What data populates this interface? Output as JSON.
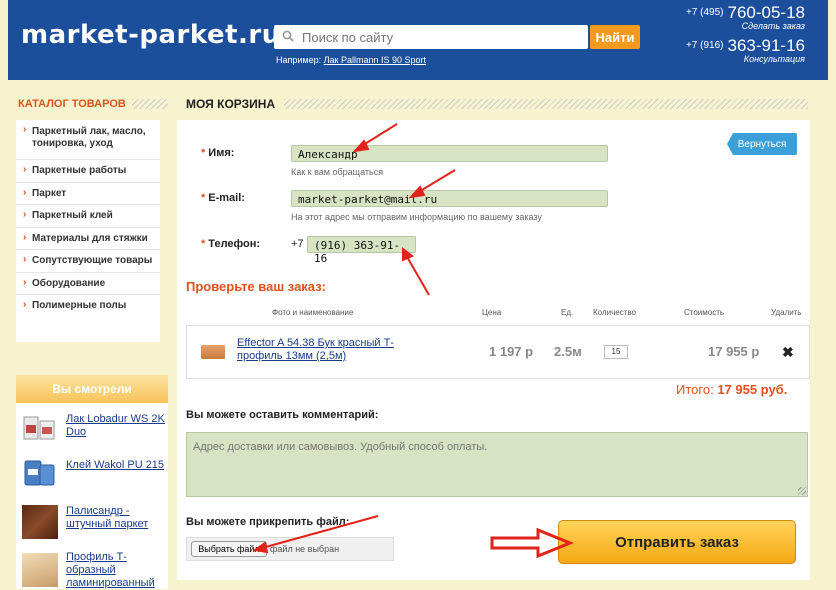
{
  "header": {
    "logo": "market-parket.ru",
    "search_placeholder": "Поиск по сайту",
    "search_button": "Найти",
    "example_prefix": "Например:",
    "example_link": "Лак Pallmann IS 90 Sport",
    "phone1": {
      "code": "+7 (495)",
      "number": "760-05-18",
      "note": "Сделать заказ"
    },
    "phone2": {
      "code": "+7 (916)",
      "number": "363-91-16",
      "note": "Консультация"
    }
  },
  "sidebar": {
    "catalog_title": "КАТАЛОГ ТОВАРОВ",
    "catalog_items": [
      "Паркетный лак, масло, тонировка, уход",
      "Паркетные работы",
      "Паркет",
      "Паркетный клей",
      "Материалы для стяжки",
      "Сопутствующие товары",
      "Оборудование",
      "Полимерные полы"
    ],
    "seen_title": "Вы смотрели",
    "seen_items": [
      "Лак Lobadur WS 2K Duo",
      "Клей Wakol PU 215",
      "Палисандр - штучный паркет",
      "Профиль Т-образный ламинированный"
    ]
  },
  "cart": {
    "title": "МОЯ КОРЗИНА",
    "back_button": "Вернуться",
    "name_label": "Имя:",
    "name_value": "Александр",
    "name_hint": "Как к вам обращаться",
    "email_label": "E-mail:",
    "email_value": "market-parket@mail.ru",
    "email_hint": "На этот адрес мы отправим информацию по вашему заказу",
    "phone_label": "Телефон:",
    "phone_prefix": "+7",
    "phone_value": "(916) 363-91-16",
    "check_title": "Проверьте ваш заказ:",
    "columns": {
      "photo_name": "Фото и наименование",
      "price": "Цена",
      "unit": "Ед.",
      "quantity": "Количество",
      "cost": "Стоимость",
      "delete": "Удалить"
    },
    "item": {
      "name": "Effector A 54.38 Бук красный Т-профиль 13мм (2,5м)",
      "price": "1 197 р",
      "unit": "2.5м",
      "quantity": "15",
      "cost": "17 955 р",
      "delete": "✖"
    },
    "total_label": "Итого:",
    "total_value": "17 955 руб.",
    "comment_label": "Вы можете оставить комментарий:",
    "comment_placeholder": "Адрес доставки или самовывоз. Удобный способ оплаты.",
    "file_label": "Вы можете прикрепить файл:",
    "file_button": "Выбрать файл",
    "file_status": "файл не выбран",
    "submit_button": "Отправить заказ"
  },
  "colors": {
    "header_blue": "#1b4f9c",
    "accent_orange": "#e0511c",
    "button_orange": "#f39a1f",
    "field_green": "#d8e3c4",
    "annotation_red": "#e2231a"
  }
}
